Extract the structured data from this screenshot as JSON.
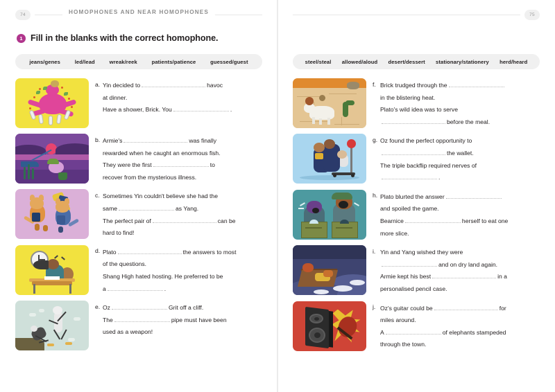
{
  "left_page": {
    "page_number": "74",
    "running_head": "HOMOPHONES AND NEAR HOMOPHONES",
    "question_number": "1",
    "instruction": "Fill in the blanks with the correct homophone.",
    "word_bank": [
      "jeans/genes",
      "led/lead",
      "wreak/reek",
      "patients/patience",
      "guessed/guest"
    ],
    "items": [
      {
        "letter": "a.",
        "image_name": "octopus-wreaking-havoc-illustration",
        "lines": [
          [
            {
              "t": "text",
              "v": "Yin decided to"
            },
            {
              "t": "blank",
              "w": "b-lg"
            },
            {
              "t": "text",
              "v": "havoc"
            }
          ],
          [
            {
              "t": "text",
              "v": "at dinner."
            }
          ],
          [
            {
              "t": "text",
              "v": "Have a shower, Brick. You"
            },
            {
              "t": "blank",
              "w": "b-md"
            },
            {
              "t": "text",
              "v": "."
            }
          ]
        ]
      },
      {
        "letter": "b.",
        "image_name": "mouse-fishing-at-sunset-illustration",
        "lines": [
          [
            {
              "t": "text",
              "v": "Armie's"
            },
            {
              "t": "blank",
              "w": "b-lg"
            },
            {
              "t": "text",
              "v": "was finally"
            }
          ],
          [
            {
              "t": "text",
              "v": "rewarded when he caught an enormous fish."
            }
          ],
          [
            {
              "t": "text",
              "v": "They were the first"
            },
            {
              "t": "blank",
              "w": "b-md"
            },
            {
              "t": "text",
              "v": "to"
            }
          ],
          [
            {
              "t": "text",
              "v": "recover from the mysterious illness."
            }
          ]
        ]
      },
      {
        "letter": "c.",
        "image_name": "two-cats-throwing-jeans-illustration",
        "lines": [
          [
            {
              "t": "text",
              "v": "Sometimes Yin couldn't believe she had the"
            }
          ],
          [
            {
              "t": "text",
              "v": "same"
            },
            {
              "t": "blank",
              "w": "b-md"
            },
            {
              "t": "text",
              "v": "as Yang."
            }
          ],
          [
            {
              "t": "text",
              "v": "The perfect pair of"
            },
            {
              "t": "blank",
              "w": "b-lg"
            },
            {
              "t": "text",
              "v": "can be"
            }
          ],
          [
            {
              "t": "text",
              "v": "hard to find!"
            }
          ]
        ]
      },
      {
        "letter": "d.",
        "image_name": "beaver-with-megaphone-at-desk-illustration",
        "lines": [
          [
            {
              "t": "text",
              "v": "Plato"
            },
            {
              "t": "blank",
              "w": "b-lg"
            },
            {
              "t": "text",
              "v": "the answers to most"
            }
          ],
          [
            {
              "t": "text",
              "v": "of the questions."
            }
          ],
          [
            {
              "t": "text",
              "v": "Shang High hated hosting. He preferred to be"
            }
          ],
          [
            {
              "t": "text",
              "v": "a"
            },
            {
              "t": "blank",
              "w": "b-md"
            },
            {
              "t": "text",
              "v": "."
            }
          ]
        ]
      },
      {
        "letter": "e.",
        "image_name": "ostrich-pushing-off-cliff-illustration",
        "lines": [
          [
            {
              "t": "text",
              "v": "Oz"
            },
            {
              "t": "blank",
              "w": "b-md"
            },
            {
              "t": "text",
              "v": "Grit off a cliff."
            }
          ],
          [
            {
              "t": "text",
              "v": "The"
            },
            {
              "t": "blank",
              "w": "b-md"
            },
            {
              "t": "text",
              "v": "pipe must have been"
            }
          ],
          [
            {
              "t": "text",
              "v": "used as a weapon!"
            }
          ]
        ]
      }
    ]
  },
  "right_page": {
    "page_number": "75",
    "word_bank": [
      "steel/steal",
      "allowed/aloud",
      "desert/dessert",
      "stationary/stationery",
      "herd/heard"
    ],
    "items": [
      {
        "letter": "f.",
        "image_name": "desert-cow-and-cactus-illustration",
        "lines": [
          [
            {
              "t": "text",
              "v": "Brick trudged through the"
            },
            {
              "t": "blank",
              "w": "b-md"
            }
          ],
          [
            {
              "t": "text",
              "v": "in the blistering heat."
            }
          ],
          [
            {
              "t": "text",
              "v": "Plato's wild idea was to serve"
            }
          ],
          [
            {
              "t": "blank",
              "w": "b-lg"
            },
            {
              "t": "text",
              "v": "before the meal."
            }
          ]
        ]
      },
      {
        "letter": "g.",
        "image_name": "characters-with-wallet-and-balloon-illustration",
        "lines": [
          [
            {
              "t": "text",
              "v": "Oz found the perfect opportunity to"
            }
          ],
          [
            {
              "t": "blank",
              "w": "b-lg"
            },
            {
              "t": "text",
              "v": "the wallet."
            }
          ],
          [
            {
              "t": "text",
              "v": "The triple backflip required nerves of"
            }
          ],
          [
            {
              "t": "blank",
              "w": "b-md"
            },
            {
              "t": "text",
              "v": "."
            }
          ]
        ]
      },
      {
        "letter": "h.",
        "image_name": "quiz-show-buzzers-illustration",
        "lines": [
          [
            {
              "t": "text",
              "v": "Plato blurted the answer"
            },
            {
              "t": "blank",
              "w": "b-md"
            }
          ],
          [
            {
              "t": "text",
              "v": "and spoiled the game."
            }
          ],
          [
            {
              "t": "text",
              "v": "Bearnice"
            },
            {
              "t": "blank",
              "w": "b-md"
            },
            {
              "t": "text",
              "v": "herself to eat one"
            }
          ],
          [
            {
              "t": "text",
              "v": "more slice."
            }
          ]
        ]
      },
      {
        "letter": "i.",
        "image_name": "shipwreck-raft-at-sea-illustration",
        "lines": [
          [
            {
              "t": "text",
              "v": "Yin and Yang wished they were"
            }
          ],
          [
            {
              "t": "blank",
              "w": "b-md"
            },
            {
              "t": "text",
              "v": "and on dry land again."
            }
          ],
          [
            {
              "t": "text",
              "v": "Armie kept his best"
            },
            {
              "t": "blank",
              "w": "b-lg"
            },
            {
              "t": "text",
              "v": "in a"
            }
          ],
          [
            {
              "t": "text",
              "v": "personalised pencil case."
            }
          ]
        ]
      },
      {
        "letter": "j.",
        "image_name": "loud-speaker-and-guitar-illustration",
        "lines": [
          [
            {
              "t": "text",
              "v": "Oz's guitar could be"
            },
            {
              "t": "blank",
              "w": "b-lg"
            },
            {
              "t": "text",
              "v": "for"
            }
          ],
          [
            {
              "t": "text",
              "v": "miles around."
            }
          ],
          [
            {
              "t": "text",
              "v": "A"
            },
            {
              "t": "blank",
              "w": "b-md"
            },
            {
              "t": "text",
              "v": "of elephants stampeded"
            }
          ],
          [
            {
              "t": "text",
              "v": "through the town."
            }
          ]
        ]
      }
    ]
  },
  "colors": {
    "marker": "#b0358c",
    "wordbank_bg": "#f0f0f0",
    "text": "#231f20",
    "runhead": "#8e8e8e"
  }
}
